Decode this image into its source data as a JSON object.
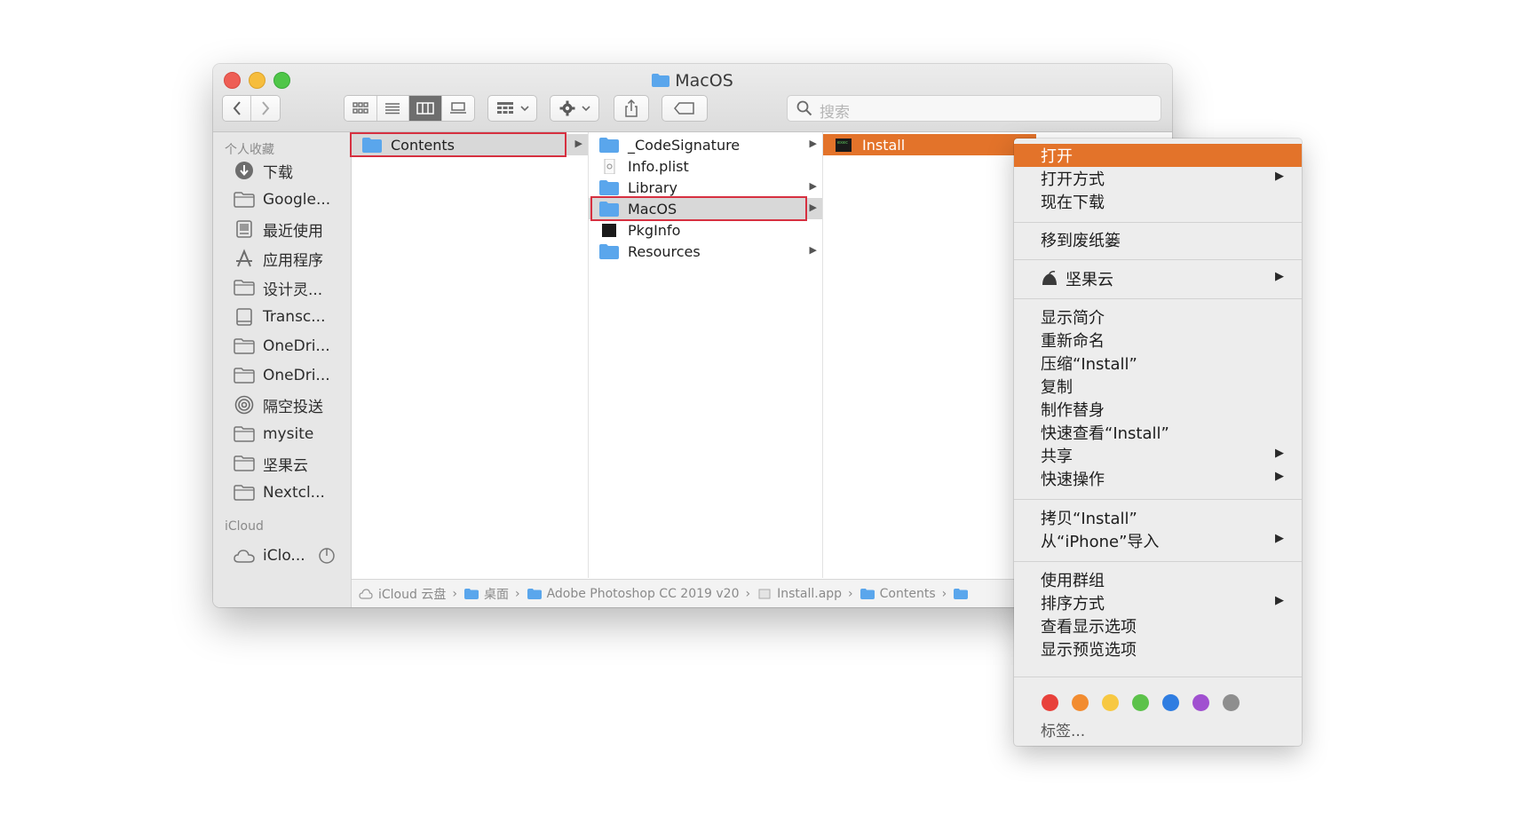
{
  "window": {
    "title": "MacOS"
  },
  "toolbar": {
    "back_icon": "chevron-left-icon",
    "forward_icon": "chevron-right-icon",
    "view_modes": [
      "icon-view-icon",
      "list-view-icon",
      "column-view-icon",
      "gallery-view-icon"
    ],
    "active_view": "column-view-icon",
    "search_placeholder": "搜索"
  },
  "sidebar": {
    "favorites_header": "个人收藏",
    "items": [
      {
        "label": "下载",
        "icon": "download-icon"
      },
      {
        "label": "Google...",
        "icon": "folder-icon"
      },
      {
        "label": "最近使用",
        "icon": "recents-icon"
      },
      {
        "label": "应用程序",
        "icon": "applications-icon"
      },
      {
        "label": "设计灵...",
        "icon": "folder-icon"
      },
      {
        "label": "Transc...",
        "icon": "disk-icon"
      },
      {
        "label": "OneDri...",
        "icon": "folder-icon"
      },
      {
        "label": "OneDri...",
        "icon": "folder-icon"
      },
      {
        "label": "隔空投送",
        "icon": "airdrop-icon"
      },
      {
        "label": "mysite",
        "icon": "folder-icon"
      },
      {
        "label": "坚果云",
        "icon": "folder-icon"
      },
      {
        "label": "Nextcl...",
        "icon": "folder-icon"
      }
    ],
    "icloud_header": "iCloud",
    "icloud_items": [
      {
        "label": "iClo...",
        "icon": "cloud-icon"
      }
    ]
  },
  "columns": {
    "col1": [
      {
        "label": "Contents",
        "type": "folder",
        "has_children": true,
        "selected": true
      }
    ],
    "col2": [
      {
        "label": "_CodeSignature",
        "type": "folder",
        "has_children": true
      },
      {
        "label": "Info.plist",
        "type": "plist",
        "has_children": false
      },
      {
        "label": "Library",
        "type": "folder",
        "has_children": true
      },
      {
        "label": "MacOS",
        "type": "folder",
        "has_children": true,
        "selected": true
      },
      {
        "label": "PkgInfo",
        "type": "binary",
        "has_children": false
      },
      {
        "label": "Resources",
        "type": "folder",
        "has_children": true
      }
    ],
    "col3": [
      {
        "label": "Install",
        "type": "executable",
        "selected": true
      }
    ]
  },
  "pathbar": {
    "segments": [
      "iCloud 云盘",
      "桌面",
      "Adobe Photoshop CC 2019 v20",
      "Install.app",
      "Contents"
    ]
  },
  "context_menu": {
    "items": {
      "open": "打开",
      "open_with": "打开方式",
      "download_now": "现在下载",
      "move_to_trash": "移到废纸篓",
      "jianguoyun": "坚果云",
      "get_info": "显示简介",
      "rename": "重新命名",
      "compress": "压缩“Install”",
      "duplicate": "复制",
      "make_alias": "制作替身",
      "quick_look": "快速查看“Install”",
      "share": "共享",
      "quick_actions": "快速操作",
      "copy": "拷贝“Install”",
      "import_iphone": "从“iPhone”导入",
      "use_groups": "使用群组",
      "sort_by": "排序方式",
      "show_view_options": "查看显示选项",
      "show_preview_options": "显示预览选项",
      "tags": "标签..."
    },
    "tag_colors": [
      "#e8413b",
      "#f28c30",
      "#f7c842",
      "#5cc24a",
      "#2f7de1",
      "#a050d0",
      "#8e8e8e"
    ]
  },
  "colors": {
    "highlight": "#e3732a",
    "annotation_box": "#d63040",
    "folder": "#5aa6ec"
  }
}
